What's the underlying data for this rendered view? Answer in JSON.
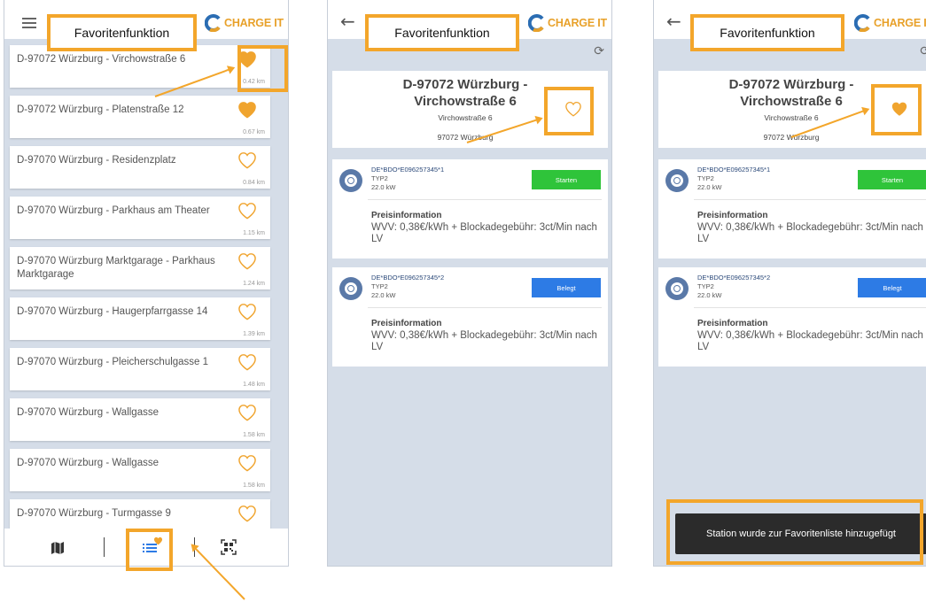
{
  "header": {
    "title": "Favoritenfunktion",
    "logo_text": "CHARGE IT"
  },
  "colors": {
    "accent": "#f3a62b",
    "heart": "#f0a42e",
    "start_button": "#2fc43a",
    "busy_button": "#2d7be5",
    "background": "#d5dde8"
  },
  "list": [
    {
      "label": "D-97072 Würzburg - Virchowstraße 6",
      "distance": "0.42 km",
      "favorite": true
    },
    {
      "label": "D-97072 Würzburg - Platenstraße 12",
      "distance": "0.67 km",
      "favorite": true
    },
    {
      "label": "D-97070 Würzburg - Residenzplatz",
      "distance": "0.84 km",
      "favorite": false
    },
    {
      "label": "D-97070 Würzburg - Parkhaus am Theater",
      "distance": "1.15 km",
      "favorite": false
    },
    {
      "label": "D-97070 Würzburg Marktgarage - Parkhaus Marktgarage",
      "distance": "1.24 km",
      "favorite": false
    },
    {
      "label": "D-97070 Würzburg - Haugerpfarrgasse 14",
      "distance": "1.39 km",
      "favorite": false
    },
    {
      "label": "D-97070 Würzburg - Pleicherschulgasse 1",
      "distance": "1.48 km",
      "favorite": false
    },
    {
      "label": "D-97070 Würzburg - Wallgasse",
      "distance": "1.58 km",
      "favorite": false
    },
    {
      "label": "D-97070 Würzburg - Wallgasse",
      "distance": "1.58 km",
      "favorite": false
    },
    {
      "label": "D-97070 Würzburg - Turmgasse 9",
      "distance": "1.67 km",
      "favorite": false
    }
  ],
  "nav": {
    "icons": [
      "map-icon",
      "favorites-list-icon",
      "qr-code-icon"
    ]
  },
  "station": {
    "title": "D-97072 Würzburg - Virchowstraße 6",
    "street": "Virchowstraße 6",
    "city": "97072 Würzburg",
    "connectors": [
      {
        "id": "DE*BDO*E096257345*1",
        "type": "TYP2",
        "power": "22.0 kW",
        "button": "Starten",
        "status": "available"
      },
      {
        "id": "DE*BDO*E096257345*2",
        "type": "TYP2",
        "power": "22.0 kW",
        "button": "Belegt",
        "status": "busy"
      }
    ],
    "price_heading": "Preisinformation",
    "price_text": "WVV: 0,38€/kWh + Blockadegebühr: 3ct/Min nach LV"
  },
  "toast": {
    "text": "Station wurde zur Favoritenliste hinzugefügt"
  }
}
